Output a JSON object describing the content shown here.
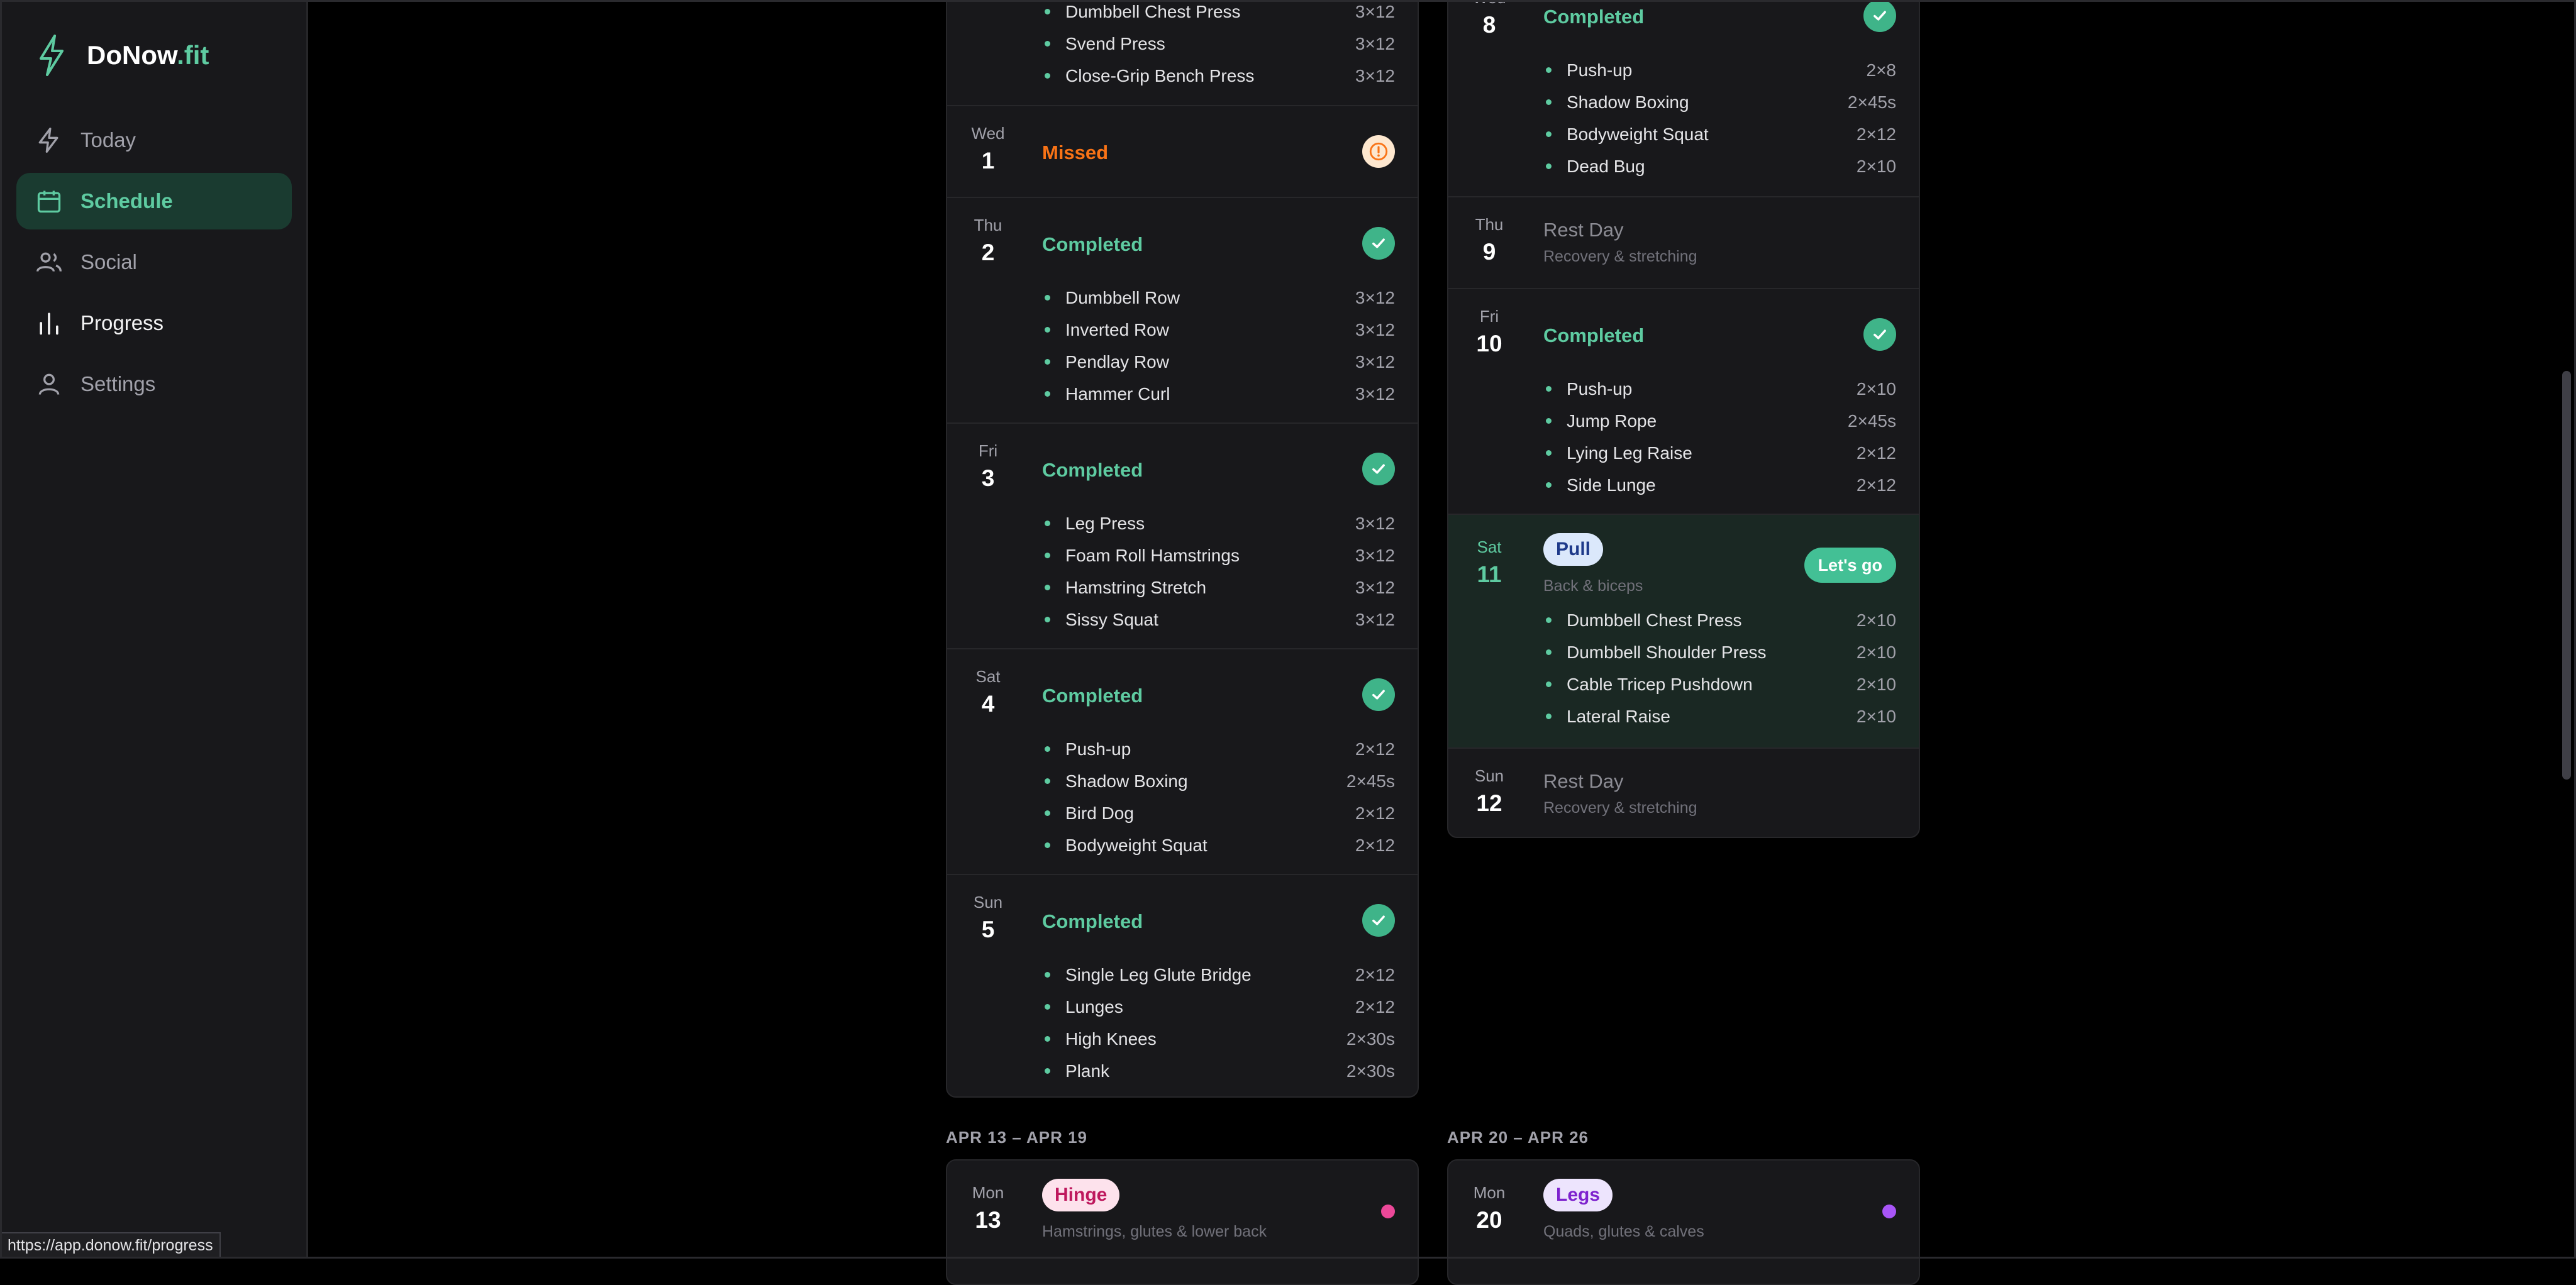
{
  "brand": {
    "name": "DoNow",
    "tld": ".fit"
  },
  "nav": [
    {
      "label": "Today",
      "icon": "bolt-icon"
    },
    {
      "label": "Schedule",
      "icon": "calendar-icon"
    },
    {
      "label": "Social",
      "icon": "users-icon"
    },
    {
      "label": "Progress",
      "icon": "bar-chart-icon"
    },
    {
      "label": "Settings",
      "icon": "user-icon"
    }
  ],
  "status_url": "https://app.donow.fit/progress",
  "left_top": {
    "exercises": [
      {
        "name": "Dumbbell Chest Press",
        "reps": "3×12"
      },
      {
        "name": "Svend Press",
        "reps": "3×12"
      },
      {
        "name": "Close-Grip Bench Press",
        "reps": "3×12"
      }
    ]
  },
  "left_days": [
    {
      "dow": "Wed",
      "num": "1",
      "status": "Missed"
    },
    {
      "dow": "Thu",
      "num": "2",
      "status": "Completed",
      "exercises": [
        {
          "name": "Dumbbell Row",
          "reps": "3×12"
        },
        {
          "name": "Inverted Row",
          "reps": "3×12"
        },
        {
          "name": "Pendlay Row",
          "reps": "3×12"
        },
        {
          "name": "Hammer Curl",
          "reps": "3×12"
        }
      ]
    },
    {
      "dow": "Fri",
      "num": "3",
      "status": "Completed",
      "exercises": [
        {
          "name": "Leg Press",
          "reps": "3×12"
        },
        {
          "name": "Foam Roll Hamstrings",
          "reps": "3×12"
        },
        {
          "name": "Hamstring Stretch",
          "reps": "3×12"
        },
        {
          "name": "Sissy Squat",
          "reps": "3×12"
        }
      ]
    },
    {
      "dow": "Sat",
      "num": "4",
      "status": "Completed",
      "exercises": [
        {
          "name": "Push-up",
          "reps": "2×12"
        },
        {
          "name": "Shadow Boxing",
          "reps": "2×45s"
        },
        {
          "name": "Bird Dog",
          "reps": "2×12"
        },
        {
          "name": "Bodyweight Squat",
          "reps": "2×12"
        }
      ]
    },
    {
      "dow": "Sun",
      "num": "5",
      "status": "Completed",
      "exercises": [
        {
          "name": "Single Leg Glute Bridge",
          "reps": "2×12"
        },
        {
          "name": "Lunges",
          "reps": "2×12"
        },
        {
          "name": "High Knees",
          "reps": "2×30s"
        },
        {
          "name": "Plank",
          "reps": "2×30s"
        }
      ]
    }
  ],
  "right_days": [
    {
      "dow": "Wed",
      "num": "8",
      "status": "Completed",
      "exercises": [
        {
          "name": "Push-up",
          "reps": "2×8"
        },
        {
          "name": "Shadow Boxing",
          "reps": "2×45s"
        },
        {
          "name": "Bodyweight Squat",
          "reps": "2×12"
        },
        {
          "name": "Dead Bug",
          "reps": "2×10"
        }
      ]
    },
    {
      "dow": "Thu",
      "num": "9",
      "status": "Rest Day",
      "sub": "Recovery & stretching"
    },
    {
      "dow": "Fri",
      "num": "10",
      "status": "Completed",
      "exercises": [
        {
          "name": "Push-up",
          "reps": "2×10"
        },
        {
          "name": "Jump Rope",
          "reps": "2×45s"
        },
        {
          "name": "Lying Leg Raise",
          "reps": "2×12"
        },
        {
          "name": "Side Lunge",
          "reps": "2×12"
        }
      ]
    },
    {
      "dow": "Sat",
      "num": "11",
      "pill": "Pull",
      "sub": "Back & biceps",
      "action": "Let's go",
      "exercises": [
        {
          "name": "Dumbbell Chest Press",
          "reps": "2×10"
        },
        {
          "name": "Dumbbell Shoulder Press",
          "reps": "2×10"
        },
        {
          "name": "Cable Tricep Pushdown",
          "reps": "2×10"
        },
        {
          "name": "Lateral Raise",
          "reps": "2×10"
        }
      ]
    },
    {
      "dow": "Sun",
      "num": "12",
      "status": "Rest Day",
      "sub": "Recovery & stretching"
    }
  ],
  "week3": {
    "label": "APR 13 – APR 19",
    "dow": "Mon",
    "num": "13",
    "pill": "Hinge",
    "sub": "Hamstrings, glutes & lower back",
    "color": "#ec4899"
  },
  "week4": {
    "label": "APR 20 – APR 26",
    "dow": "Mon",
    "num": "20",
    "pill": "Legs",
    "sub": "Quads, glutes & calves",
    "color": "#a855f7"
  },
  "colors": {
    "accent": "#5ecba1",
    "missed": "#f97316",
    "bg": "#000000",
    "panel": "#18181b"
  }
}
